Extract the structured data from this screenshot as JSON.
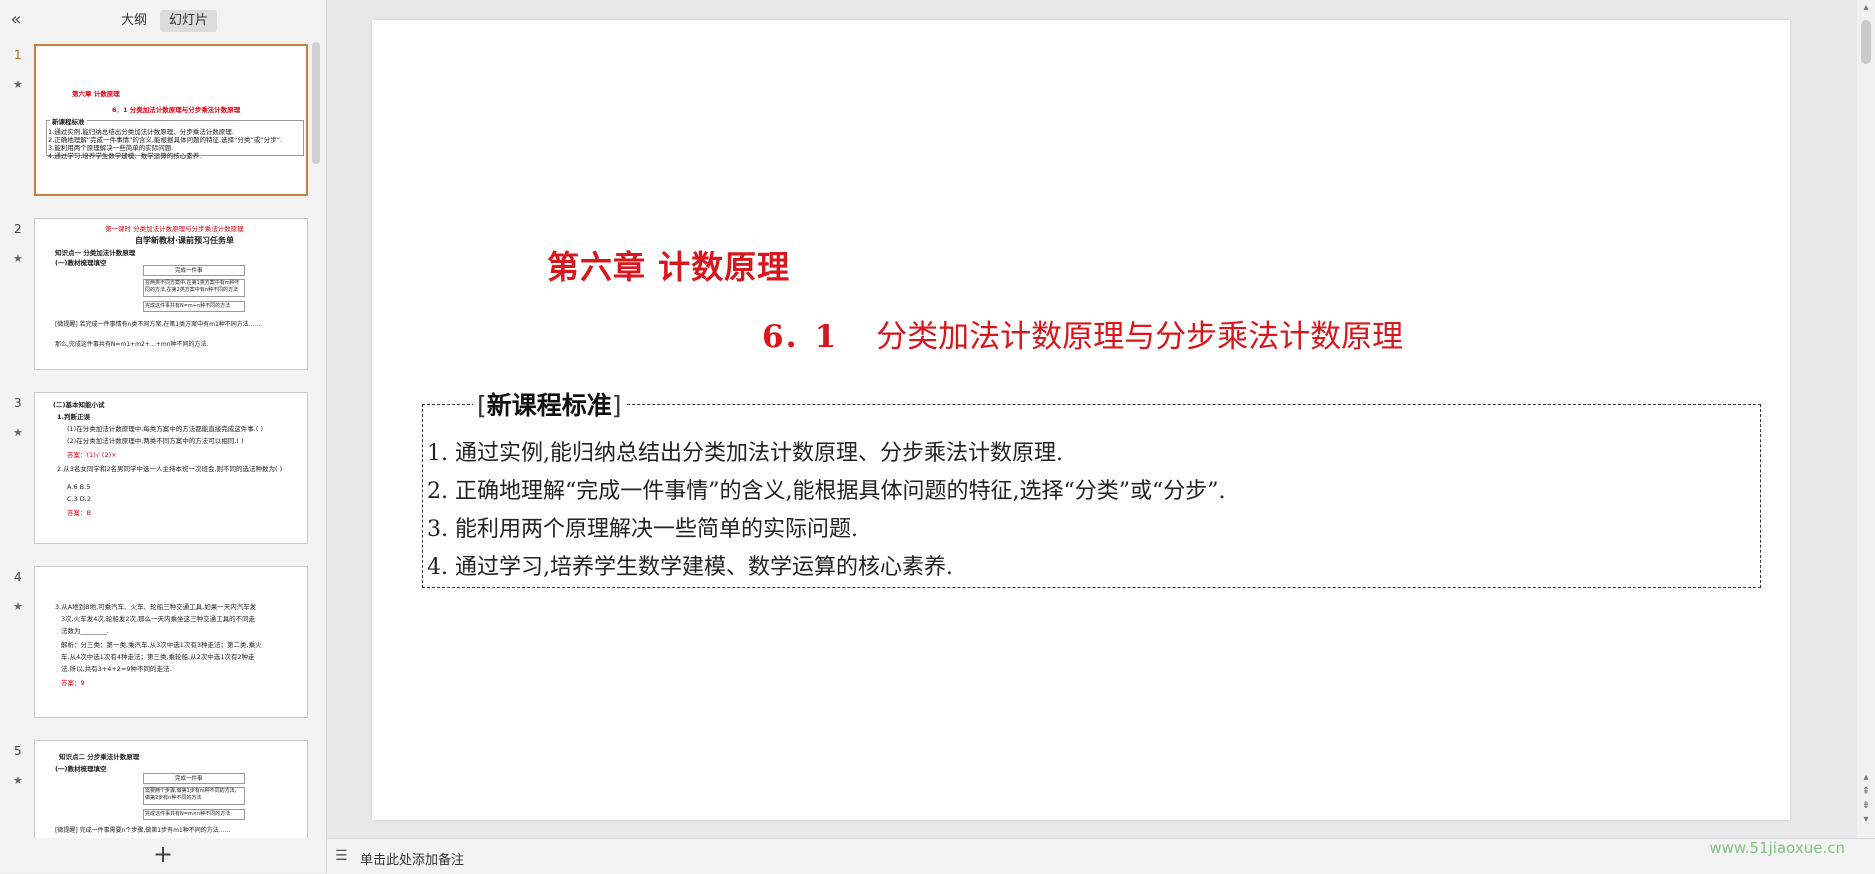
{
  "panel": {
    "tab_outline": "大纲",
    "tab_slides": "幻灯片"
  },
  "thumbnails": [
    {
      "num": "1",
      "lines": [
        "第六章 计数原理",
        "6．1 分类加法计数原理与分步乘法计数原理",
        "新课程标准",
        "1.通过实例,能归纳总结出分类加法计数原理、分步乘法计数原理.",
        "2.正确地理解“完成一件事情”的含义,能根据具体问题的特征,选择“分类”或“分步”.",
        "3.能利用两个原理解决一些简单的实际问题.",
        "4.通过学习,培养学生数学建模、数学运算的核心素养."
      ]
    },
    {
      "num": "2",
      "lines": [
        "第一课时 分类加法计数原理与分步乘法计数原理",
        "自学新教材·课前预习任务单",
        "知识点一 分类加法计数原理",
        "(一)教材梳理填空",
        "完成一件事",
        "在两类不同方案中,在第1类方案中有m种不同的方法,在第2类方案中有n种不同的方法",
        "完成这件事共有N=m+n种不同的方法",
        "[微提醒] 若完成一件事情有n类不同方案,在第1类方案中有m1种不同方法……",
        "那么,完成这件事共有N=m1+m2+…+mn种不同的方法."
      ]
    },
    {
      "num": "3",
      "lines": [
        "(二)基本知能小试",
        "1.判断正误",
        "(1)在分类加法计数原理中,每类方案中的方法都能直接完成这件事.( )",
        "(2)在分类加法计数原理中,两类不同方案中的方法可以相同.( )",
        "答案：(1)√ (2)×",
        "2.从3名女同学和2名男同学中选一人主持本班一次班会,则不同的选法种数为( )",
        "A.6 B.5",
        "C.3 D.2",
        "答案：B"
      ]
    },
    {
      "num": "4",
      "lines": [
        "3.从A地到B地,可乘汽车、火车、轮船三种交通工具,如果一天内汽车发",
        "3次,火车发4次,轮船发2次,那么一天内乘坐这三种交通工具的不同走",
        "法数为________.",
        "解析：分三类：第一类,乘汽车,从3次中选1次有3种走法；第二类,乘火",
        "车,从4次中选1次有4种走法；第三类,乘轮船,从2次中选1次有2种走",
        "法.所以,共有3+4+2=9种不同的走法.",
        "答案：9"
      ]
    },
    {
      "num": "5",
      "lines": [
        "知识点二 分步乘法计数原理",
        "(一)教材梳理填空",
        "完成一件事",
        "需要两个步骤,做第1步有m种不同的方法,做第2步有n种不同的方法",
        "完成这件事共有N=m×n种不同的方法",
        "[微提醒] 完成一件事需要n个步骤,做第1步有m1种不同的方法……"
      ]
    }
  ],
  "slide": {
    "chapter_title": "第六章  计数原理",
    "section_number": "6．1",
    "section_title": "分类加法计数原理与分步乘法计数原理",
    "standard_label": "新课程标准",
    "standards": [
      "1. 通过实例,能归纳总结出分类加法计数原理、分步乘法计数原理.",
      "2. 正确地理解“完成一件事情”的含义,能根据具体问题的特征,选择“分类”或“分步”.",
      "3. 能利用两个原理解决一些简单的实际问题.",
      "4. 通过学习,培养学生数学建模、数学运算的核心素养."
    ]
  },
  "notes": {
    "placeholder": "单击此处添加备注"
  },
  "watermark": "www.51jiaoxue.cn"
}
